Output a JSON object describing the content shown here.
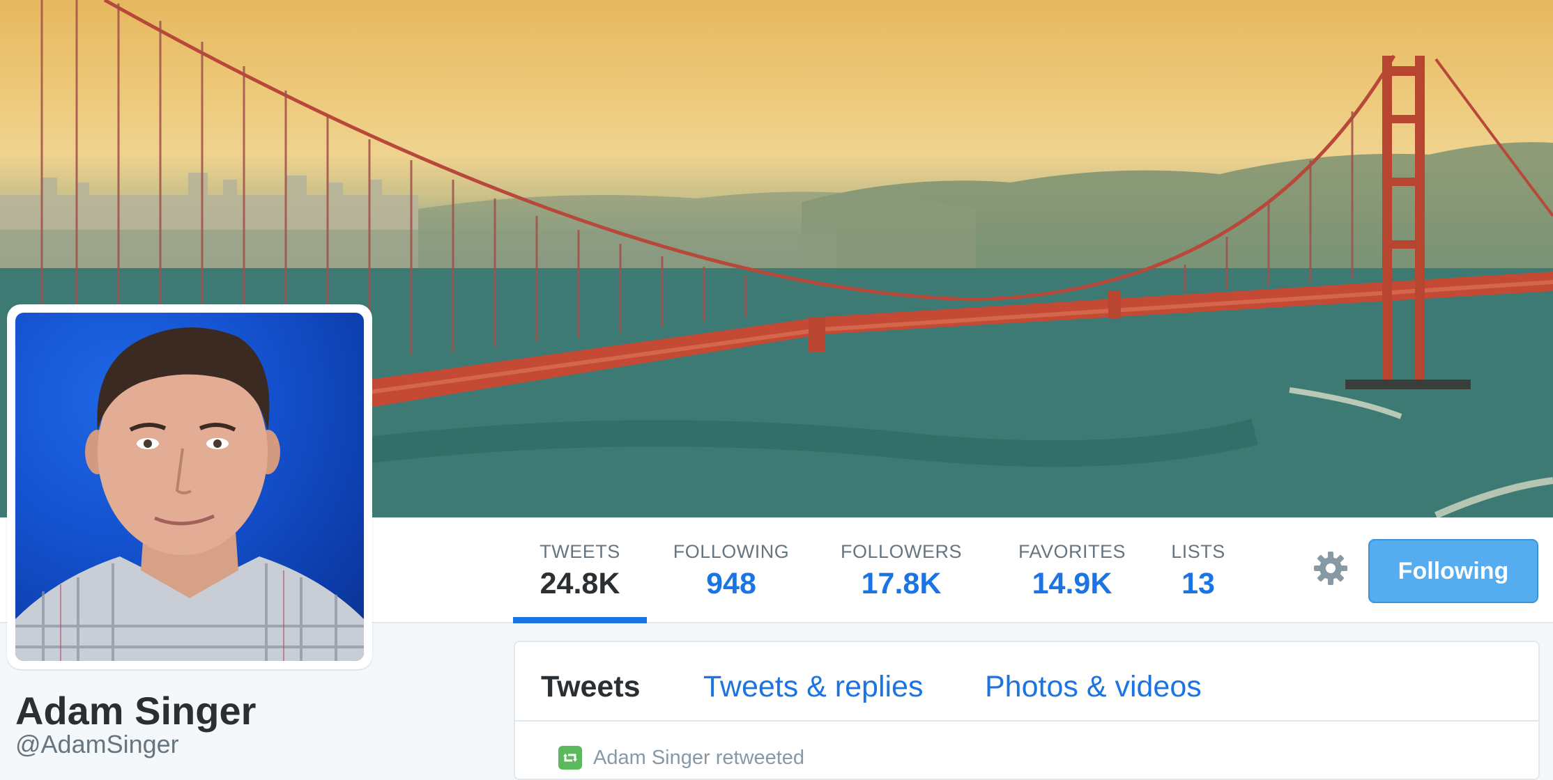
{
  "profile": {
    "name": "Adam Singer",
    "handle": "@AdamSinger"
  },
  "stats": [
    {
      "label": "TWEETS",
      "value": "24.8K",
      "active": true
    },
    {
      "label": "FOLLOWING",
      "value": "948"
    },
    {
      "label": "FOLLOWERS",
      "value": "17.8K"
    },
    {
      "label": "FAVORITES",
      "value": "14.9K"
    },
    {
      "label": "LISTS",
      "value": "13"
    }
  ],
  "actions": {
    "follow_label": "Following",
    "settings_icon": "gear-icon"
  },
  "timeline": {
    "tabs": [
      {
        "label": "Tweets",
        "active": true
      },
      {
        "label": "Tweets & replies"
      },
      {
        "label": "Photos & videos"
      }
    ],
    "retweet_context": "Adam Singer retweeted",
    "retweet_icon": "retweet-icon"
  },
  "colors": {
    "link_blue": "#1b74e4",
    "follow_button": "#55acee",
    "text_dark": "#292f33",
    "text_muted": "#66757f"
  }
}
